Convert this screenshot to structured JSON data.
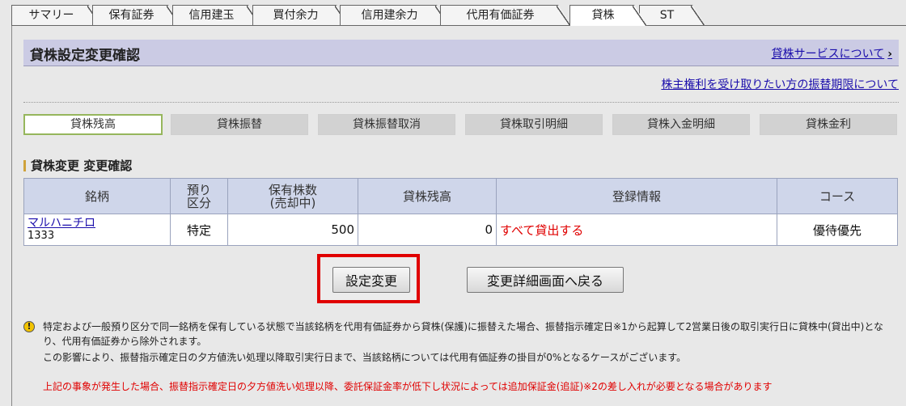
{
  "tabs": [
    {
      "label": "サマリー",
      "active": false
    },
    {
      "label": "保有証券",
      "active": false
    },
    {
      "label": "信用建玉",
      "active": false
    },
    {
      "label": "買付余力",
      "active": false
    },
    {
      "label": "信用建余力",
      "active": false
    },
    {
      "label": "代用有価証券",
      "active": false
    },
    {
      "label": "貸株",
      "active": true
    },
    {
      "label": "ST",
      "active": false
    }
  ],
  "header": {
    "title": "貸株設定変更確認",
    "service_link": "貸株サービスについて",
    "rights_link": "株主権利を受け取りたい方の振替期限について"
  },
  "subnav": [
    {
      "label": "貸株残高",
      "active": true
    },
    {
      "label": "貸株振替",
      "active": false
    },
    {
      "label": "貸株振替取消",
      "active": false
    },
    {
      "label": "貸株取引明細",
      "active": false
    },
    {
      "label": "貸株入金明細",
      "active": false
    },
    {
      "label": "貸株金利",
      "active": false
    }
  ],
  "section_title": "貸株変更 変更確認",
  "table": {
    "headers": {
      "name": "銘柄",
      "account_1": "預り",
      "account_2": "区分",
      "qty_1": "保有株数",
      "qty_2": "(売却中)",
      "balance": "貸株残高",
      "registration": "登録情報",
      "course": "コース"
    },
    "rows": [
      {
        "name": "マルハニチロ",
        "code": "1333",
        "account": "特定",
        "qty": "500",
        "balance": "0",
        "registration": "すべて貸出する",
        "course": "優待優先"
      }
    ]
  },
  "buttons": {
    "change": "設定変更",
    "back": "変更詳細画面へ戻る"
  },
  "notes": {
    "icon": "!",
    "line1": "特定および一般預り区分で同一銘柄を保有している状態で当該銘柄を代用有価証券から貸株(保護)に振替えた場合、振替指示確定日※1から起算して2営業日後の取引実行日に貸株中(貸出中)となり、代用有価証券から除外されます。",
    "line2": "この影響により、振替指示確定日の夕方値洗い処理以降取引実行日まで、当該銘柄については代用有価証券の掛目が0%となるケースがございます。",
    "line3": "上記の事象が発生した場合、振替指示確定日の夕方値洗い処理以降、委託保証金率が低下し状況によっては追加保証金(追証)※2の差し入れが必要となる場合があります"
  },
  "colors": {
    "title_bg": "#cbcbe4",
    "table_header_bg": "#cfd6ea",
    "link": "#1a0dab",
    "alert_red": "#e00000",
    "active_subnav_border": "#96b65c"
  }
}
